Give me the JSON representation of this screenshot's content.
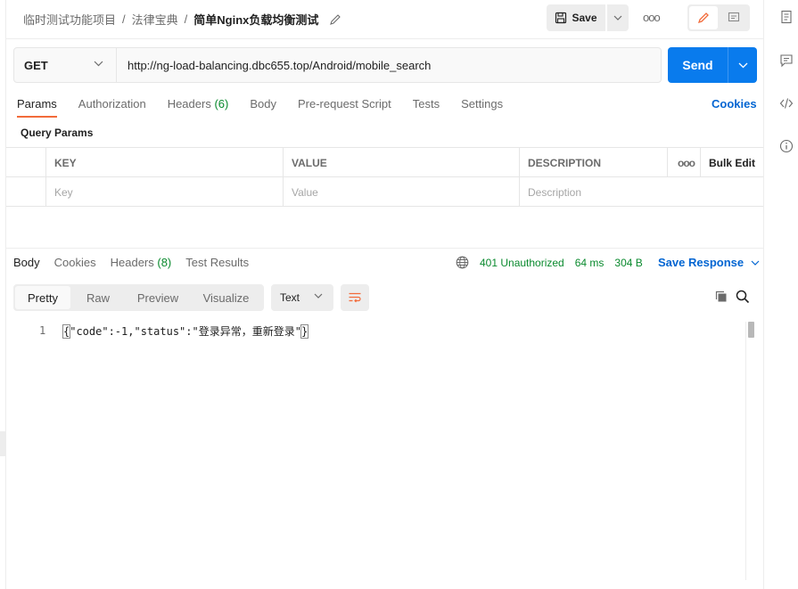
{
  "breadcrumb": {
    "workspace": "临时测试功能项目",
    "collection": "法律宝典",
    "request": "简单Nginx负载均衡测试",
    "separator": "/"
  },
  "toolbar": {
    "save_label": "Save",
    "more": "ooo"
  },
  "request": {
    "method": "GET",
    "url": "http://ng-load-balancing.dbc655.top/Android/mobile_search",
    "send_label": "Send"
  },
  "tabs": {
    "params": "Params",
    "authorization": "Authorization",
    "headers": "Headers",
    "headers_count": "(6)",
    "body": "Body",
    "pre_request": "Pre-request Script",
    "tests": "Tests",
    "settings": "Settings",
    "cookies": "Cookies"
  },
  "params": {
    "title": "Query Params",
    "headers": {
      "key": "KEY",
      "value": "VALUE",
      "description": "DESCRIPTION",
      "more": "ooo",
      "bulk_edit": "Bulk Edit"
    },
    "placeholders": {
      "key": "Key",
      "value": "Value",
      "description": "Description"
    }
  },
  "response": {
    "tabs": {
      "body": "Body",
      "cookies": "Cookies",
      "headers": "Headers",
      "headers_count": "(8)",
      "test_results": "Test Results"
    },
    "status": "401 Unauthorized",
    "time": "64 ms",
    "size": "304 B",
    "save_response": "Save Response",
    "views": {
      "pretty": "Pretty",
      "raw": "Raw",
      "preview": "Preview",
      "visualize": "Visualize"
    },
    "format": "Text",
    "line_number": "1",
    "code_open": "{",
    "code_body": "\"code\":-1,\"status\":\"登录异常，重新登录\"",
    "code_close": "}"
  },
  "colors": {
    "send": "#097bed",
    "accent_tab": "#f26b3a",
    "link": "#0265d2",
    "status_ok": "#0a8a2e"
  }
}
